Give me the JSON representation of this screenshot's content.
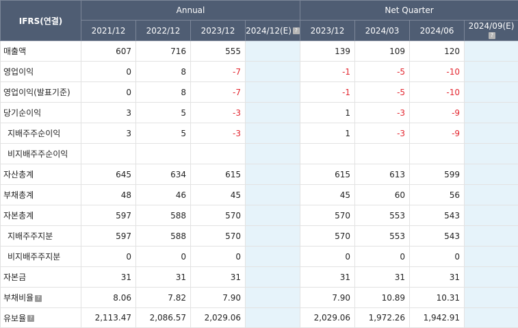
{
  "header": {
    "corner": "IFRS(연결)",
    "group_annual": "Annual",
    "group_quarter": "Net Quarter",
    "periods": [
      {
        "label": "2021/12",
        "est": false
      },
      {
        "label": "2022/12",
        "est": false
      },
      {
        "label": "2023/12",
        "est": false
      },
      {
        "label": "2024/12(E)",
        "est": true
      },
      {
        "label": "2023/12",
        "est": false
      },
      {
        "label": "2024/03",
        "est": false
      },
      {
        "label": "2024/06",
        "est": false
      },
      {
        "label": "2024/09(E)",
        "est": true
      }
    ]
  },
  "rows": [
    {
      "label": "매출액",
      "indent": false,
      "help": false,
      "values": [
        "607",
        "716",
        "555",
        "",
        "139",
        "109",
        "120",
        ""
      ]
    },
    {
      "label": "영업이익",
      "indent": false,
      "help": false,
      "values": [
        "0",
        "8",
        "-7",
        "",
        "-1",
        "-5",
        "-10",
        ""
      ]
    },
    {
      "label": "영업이익(발표기준)",
      "indent": false,
      "help": false,
      "values": [
        "0",
        "8",
        "-7",
        "",
        "-1",
        "-5",
        "-10",
        ""
      ]
    },
    {
      "label": "당기순이익",
      "indent": false,
      "help": false,
      "values": [
        "3",
        "5",
        "-3",
        "",
        "1",
        "-3",
        "-9",
        ""
      ]
    },
    {
      "label": "지배주주순이익",
      "indent": true,
      "help": false,
      "values": [
        "3",
        "5",
        "-3",
        "",
        "1",
        "-3",
        "-9",
        ""
      ]
    },
    {
      "label": "비지배주주순이익",
      "indent": true,
      "help": false,
      "values": [
        "",
        "",
        "",
        "",
        "",
        "",
        "",
        ""
      ]
    },
    {
      "label": "자산총계",
      "indent": false,
      "help": false,
      "values": [
        "645",
        "634",
        "615",
        "",
        "615",
        "613",
        "599",
        ""
      ]
    },
    {
      "label": "부채총계",
      "indent": false,
      "help": false,
      "values": [
        "48",
        "46",
        "45",
        "",
        "45",
        "60",
        "56",
        ""
      ]
    },
    {
      "label": "자본총계",
      "indent": false,
      "help": false,
      "values": [
        "597",
        "588",
        "570",
        "",
        "570",
        "553",
        "543",
        ""
      ]
    },
    {
      "label": "지배주주지분",
      "indent": true,
      "help": false,
      "values": [
        "597",
        "588",
        "570",
        "",
        "570",
        "553",
        "543",
        ""
      ]
    },
    {
      "label": "비지배주주지분",
      "indent": true,
      "help": false,
      "values": [
        "0",
        "0",
        "0",
        "",
        "0",
        "0",
        "0",
        ""
      ]
    },
    {
      "label": "자본금",
      "indent": false,
      "help": false,
      "values": [
        "31",
        "31",
        "31",
        "",
        "31",
        "31",
        "31",
        ""
      ]
    },
    {
      "label": "부채비율",
      "indent": false,
      "help": true,
      "values": [
        "8.06",
        "7.82",
        "7.90",
        "",
        "7.90",
        "10.89",
        "10.31",
        ""
      ]
    },
    {
      "label": "유보율",
      "indent": false,
      "help": true,
      "values": [
        "2,113.47",
        "2,086.57",
        "2,029.06",
        "",
        "2,029.06",
        "1,972.26",
        "1,942.91",
        ""
      ]
    }
  ],
  "help_glyph": "?",
  "colors": {
    "header_bg": "#4f5d73",
    "negative": "#e3262f",
    "estimate_bg": "#e6f3fa"
  }
}
